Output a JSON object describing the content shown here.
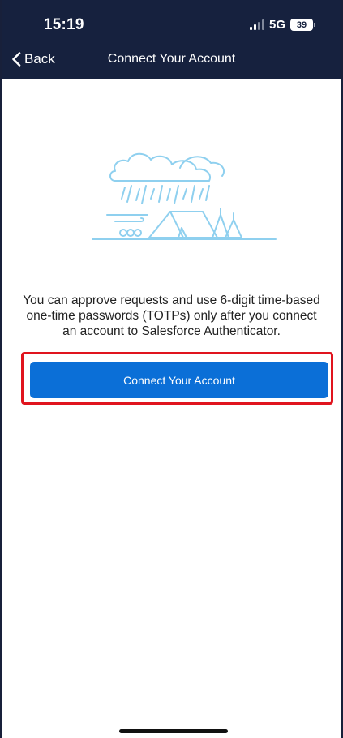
{
  "status_bar": {
    "time": "15:19",
    "network": "5G",
    "battery": "39"
  },
  "nav": {
    "back_label": "Back",
    "title": "Connect Your Account"
  },
  "main": {
    "illustration_icon": "rainy-campsite-illustration",
    "message": "You can approve requests and use 6-digit time-based one-time passwords (TOTPs) only after you connect an account to Salesforce Authenticator.",
    "button_label": "Connect Your Account"
  },
  "colors": {
    "nav_background": "#16213e",
    "button": "#0b6fd7",
    "highlight": "#e0141e",
    "illustration": "#8fd0ef"
  }
}
